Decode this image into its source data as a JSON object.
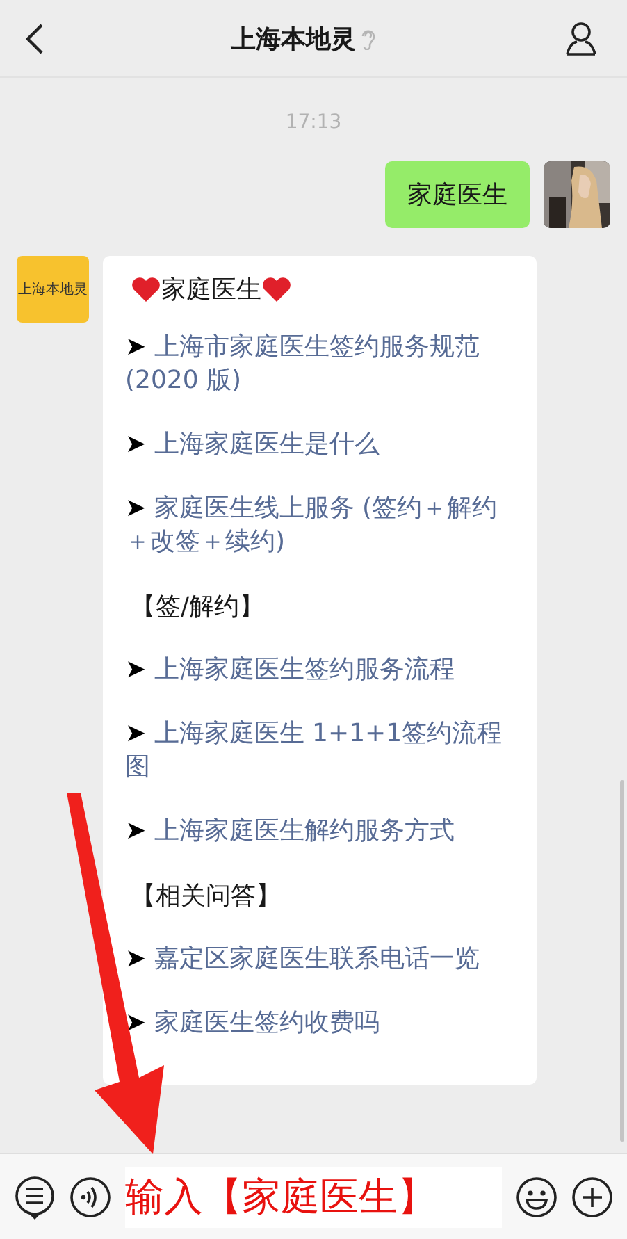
{
  "header": {
    "title": "上海本地灵"
  },
  "time": "17:13",
  "messages": [
    {
      "kind": "sent",
      "text": "家庭医生"
    },
    {
      "kind": "article",
      "avatar_text": "上海本地灵",
      "lines": [
        {
          "kind": "title",
          "text": "家庭医生"
        },
        {
          "kind": "link",
          "bullet": "➤",
          "text": "上海市家庭医生签约服务规范 (2020 版)"
        },
        {
          "kind": "link",
          "bullet": "➤",
          "text": "上海家庭医生是什么"
        },
        {
          "kind": "link",
          "bullet": "➤",
          "text": "家庭医生线上服务 (签约＋解约＋改签＋续约)"
        },
        {
          "kind": "section",
          "text": "【签/解约】"
        },
        {
          "kind": "link",
          "bullet": "➤",
          "text": "上海家庭医生签约服务流程"
        },
        {
          "kind": "link",
          "bullet": "➤",
          "text": "上海家庭医生 1+1+1签约流程图"
        },
        {
          "kind": "link",
          "bullet": "➤",
          "text": "上海家庭医生解约服务方式"
        },
        {
          "kind": "section",
          "text": "【相关问答】"
        },
        {
          "kind": "link",
          "bullet": "➤",
          "text": "嘉定区家庭医生联系电话一览"
        },
        {
          "kind": "link",
          "bullet": "➤",
          "text": "家庭医生签约收费吗"
        }
      ]
    }
  ],
  "annotation": {
    "text": "输入【家庭医生】"
  }
}
